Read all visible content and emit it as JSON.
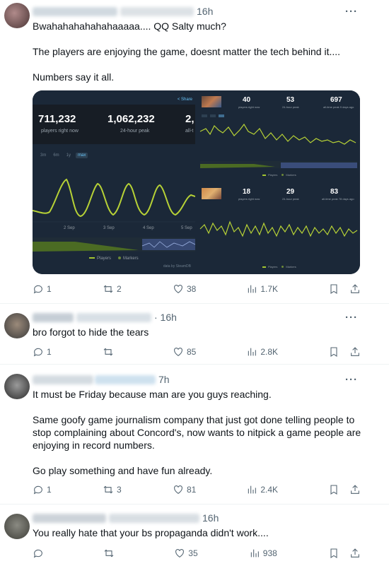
{
  "tweets": [
    {
      "time": "16h",
      "paragraphs": [
        "Bwahahahahahahaaaaa.... QQ Salty much?",
        "The players are enjoying the game, doesnt matter the tech behind it....",
        "Numbers say it all."
      ],
      "actions": {
        "replies": "1",
        "reposts": "2",
        "likes": "38",
        "views": "1.7K"
      }
    },
    {
      "time": "· 16h",
      "paragraphs": [
        "bro forgot to hide the tears"
      ],
      "actions": {
        "replies": "1",
        "reposts": "",
        "likes": "85",
        "views": "2.8K"
      }
    },
    {
      "time": "7h",
      "paragraphs": [
        "It must be Friday because man are you guys reaching.",
        "Same goofy game journalism company that just got done telling people to stop complaining about Concord's, now wants to nitpick a game people are enjoying in record numbers.",
        "Go play something and have fun already."
      ],
      "actions": {
        "replies": "1",
        "reposts": "3",
        "likes": "81",
        "views": "2.4K"
      }
    },
    {
      "time": "16h",
      "paragraphs": [
        "You really hate that your bs propaganda didn't work...."
      ],
      "actions": {
        "replies": "",
        "reposts": "",
        "likes": "35",
        "views": "938"
      }
    }
  ],
  "media": {
    "big": {
      "share": "< Share",
      "stats": [
        {
          "value": "711,232",
          "label": "players right now"
        },
        {
          "value": "1,062,232",
          "label": "24-hour peak"
        },
        {
          "value": "2,",
          "label": "all-t"
        }
      ],
      "tabs": [
        "3m",
        "6m",
        "1y",
        "max"
      ],
      "x_labels": [
        "2 Sep",
        "3 Sep",
        "4 Sep",
        "5 Sep"
      ],
      "legend": [
        "Players",
        "Markers"
      ],
      "credit": "data by SteamDB"
    },
    "small_top": {
      "stats": [
        {
          "value": "40",
          "label": "players right now"
        },
        {
          "value": "53",
          "label": "24-hour peak"
        },
        {
          "value": "697",
          "label": "all-time peak 9 days ago"
        }
      ],
      "legend": [
        "Players",
        "Markers"
      ]
    },
    "small_bottom": {
      "stats": [
        {
          "value": "18",
          "label": "players right now"
        },
        {
          "value": "29",
          "label": "24-hour peak"
        },
        {
          "value": "83",
          "label": "all-time peak 78 days ago"
        }
      ],
      "legend": [
        "Players",
        "Markers"
      ]
    }
  },
  "colors": {
    "accent": "#a3c530",
    "steam_bg": "#1b2838",
    "muted": "#536471"
  }
}
